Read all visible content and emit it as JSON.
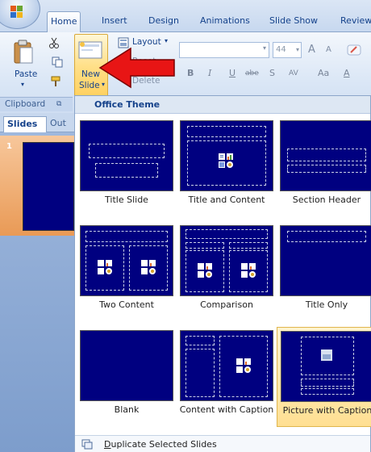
{
  "ribbon": {
    "tabs": [
      "Home",
      "Insert",
      "Design",
      "Animations",
      "Slide Show",
      "Review"
    ],
    "active_tab": "Home",
    "paste_label": "Paste",
    "new_slide_label_1": "New",
    "new_slide_label_2": "Slide",
    "layout_label": "Layout",
    "reset_label": "Reset",
    "delete_label": "Delete",
    "font_size_value": "44",
    "grow_font_label": "A",
    "shrink_font_label": "A",
    "fmt_bold": "B",
    "fmt_italic": "I",
    "fmt_underline": "U",
    "fmt_strike": "abe",
    "fmt_shadow": "S",
    "fmt_spacing": "AV",
    "fmt_case": "Aa",
    "fmt_color": "A",
    "clipboard_group": "Clipboard"
  },
  "pane": {
    "slides_tab": "Slides",
    "outline_tab": "Out",
    "slide_number": "1"
  },
  "gallery": {
    "heading": "Office Theme",
    "layouts": [
      {
        "label": "Title Slide"
      },
      {
        "label": "Title and Content"
      },
      {
        "label": "Section Header"
      },
      {
        "label": "Two Content"
      },
      {
        "label": "Comparison"
      },
      {
        "label": "Title Only"
      },
      {
        "label": "Blank"
      },
      {
        "label": "Content with Caption"
      },
      {
        "label": "Picture with Caption"
      }
    ],
    "selected_layout": "Picture with Caption",
    "footer_underlined": "D",
    "footer_rest": "uplicate Selected Slides"
  },
  "colors": {
    "slide_bg": "#000080",
    "accent_selected": "#ffdf92",
    "arrow": "#e81515"
  }
}
